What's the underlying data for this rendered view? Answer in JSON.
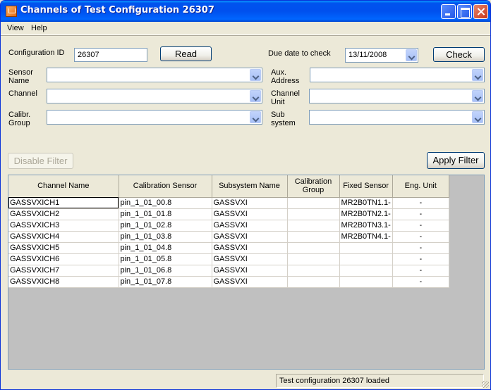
{
  "window": {
    "title": "Channels of Test Configuration 26307"
  },
  "menu": {
    "items": [
      "View",
      "Help"
    ]
  },
  "form": {
    "config_id_label": "Configuration ID",
    "config_id_value": "26307",
    "read_label": "Read",
    "due_date_label": "Due date to check",
    "due_date_value": "13/11/2008",
    "check_label": "Check",
    "sensor_name_label": "Sensor\nName",
    "channel_label": "Channel",
    "calibr_group_label": "Calibr.\nGroup",
    "aux_address_label": "Aux.\nAddress",
    "channel_unit_label": "Channel\nUnit",
    "sub_system_label": "Sub\nsystem",
    "disable_filter_label": "Disable Filter",
    "apply_filter_label": "Apply Filter"
  },
  "grid": {
    "columns": [
      "Channel Name",
      "Calibration Sensor",
      "Subsystem Name",
      "Calibration Group",
      "Fixed Sensor",
      "Eng. Unit"
    ],
    "rows": [
      [
        "GASSVXICH1",
        "pin_1_01_00.8",
        "GASSVXI",
        "",
        "MR2B0TN1.1-",
        "-"
      ],
      [
        "GASSVXICH2",
        "pin_1_01_01.8",
        "GASSVXI",
        "",
        "MR2B0TN2.1-",
        "-"
      ],
      [
        "GASSVXICH3",
        "pin_1_01_02.8",
        "GASSVXI",
        "",
        "MR2B0TN3.1-",
        "-"
      ],
      [
        "GASSVXICH4",
        "pin_1_01_03.8",
        "GASSVXI",
        "",
        "MR2B0TN4.1-",
        "-"
      ],
      [
        "GASSVXICH5",
        "pin_1_01_04.8",
        "GASSVXI",
        "",
        "",
        "-"
      ],
      [
        "GASSVXICH6",
        "pin_1_01_05.8",
        "GASSVXI",
        "",
        "",
        "-"
      ],
      [
        "GASSVXICH7",
        "pin_1_01_06.8",
        "GASSVXI",
        "",
        "",
        "-"
      ],
      [
        "GASSVXICH8",
        "pin_1_01_07.8",
        "GASSVXI",
        "",
        "",
        "-"
      ]
    ]
  },
  "status": {
    "text": "Test configuration 26307 loaded"
  }
}
